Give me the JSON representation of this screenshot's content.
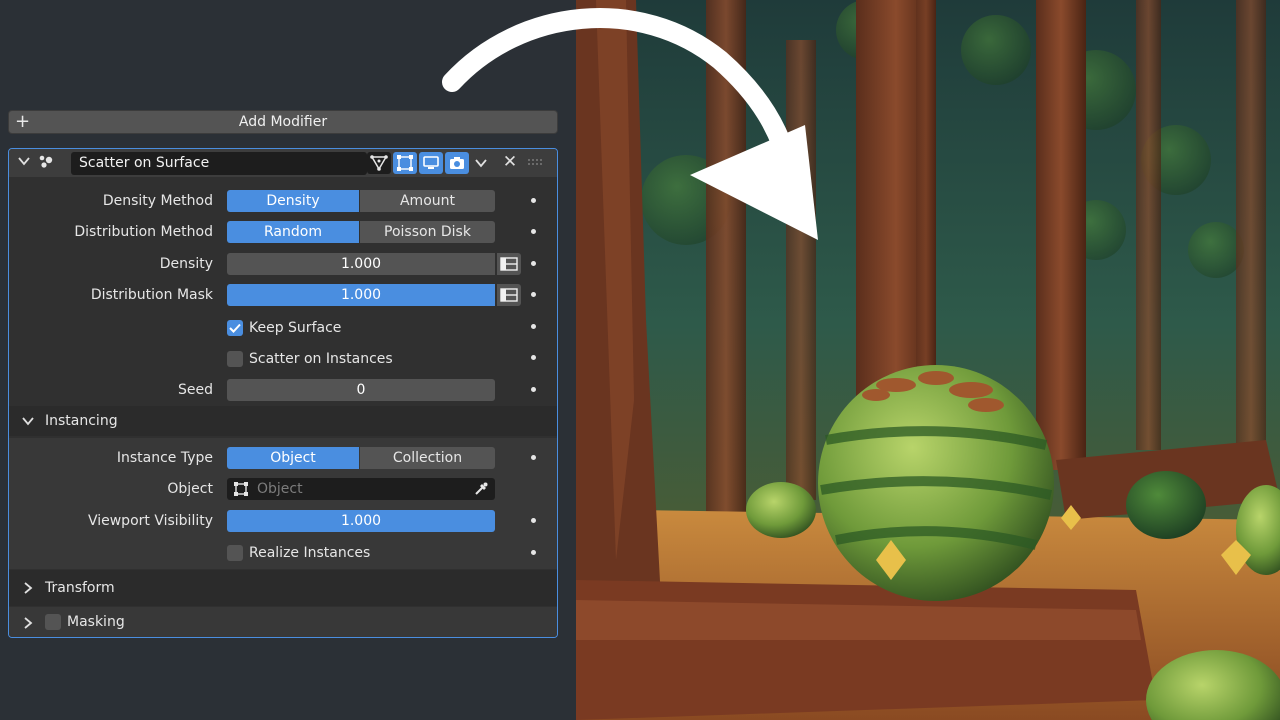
{
  "add_modifier": {
    "label": "Add Modifier",
    "icon": "plus-icon"
  },
  "modifier": {
    "name": "Scatter on Surface",
    "header_icons": [
      "collapse-chevron-icon",
      "geometry-nodes-icon",
      "edit-mode-icon",
      "on-cage-icon",
      "viewport-icon",
      "render-camera-icon",
      "dropdown-chevron-icon",
      "close-icon",
      "drag-grip-icon"
    ],
    "density_method": {
      "label": "Density Method",
      "options": [
        "Density",
        "Amount"
      ],
      "selected": "Density"
    },
    "distribution_method": {
      "label": "Distribution Method",
      "options": [
        "Random",
        "Poisson Disk"
      ],
      "selected": "Random"
    },
    "density": {
      "label": "Density",
      "value": "1.000"
    },
    "distribution_mask": {
      "label": "Distribution Mask",
      "value": "1.000",
      "fill": 1.0
    },
    "keep_surface": {
      "label": "Keep Surface",
      "checked": true
    },
    "scatter_on_instances": {
      "label": "Scatter on Instances",
      "checked": false
    },
    "seed": {
      "label": "Seed",
      "value": "0"
    },
    "instancing": {
      "title": "Instancing",
      "expanded": true,
      "instance_type": {
        "label": "Instance Type",
        "options": [
          "Object",
          "Collection"
        ],
        "selected": "Object"
      },
      "object": {
        "label": "Object",
        "placeholder": "Object"
      },
      "viewport_visibility": {
        "label": "Viewport Visibility",
        "value": "1.000",
        "fill": 1.0
      },
      "realize_instances": {
        "label": "Realize Instances",
        "checked": false
      }
    },
    "transform": {
      "title": "Transform",
      "expanded": false
    },
    "masking": {
      "title": "Masking",
      "expanded": false,
      "enabled": false
    }
  },
  "colors": {
    "accent": "#4a8ee0",
    "panel_bg": "#303030",
    "field_bg": "#545454",
    "arrow": "#ffffff"
  }
}
